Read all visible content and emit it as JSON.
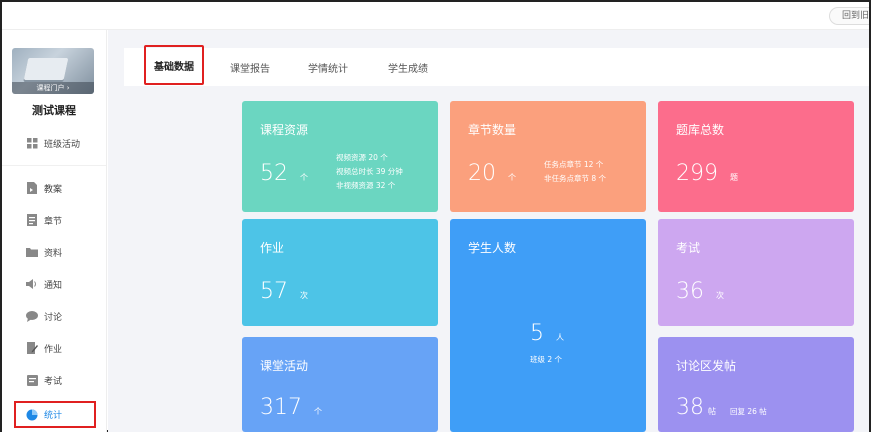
{
  "topbar": {
    "back_label": "回到旧"
  },
  "sidebar": {
    "portal_label": "课程门户 ›",
    "course_name": "测试课程",
    "items": [
      {
        "label": "班级活动",
        "icon": "grid-icon"
      },
      {
        "label": "教案",
        "icon": "doc-icon"
      },
      {
        "label": "章节",
        "icon": "list-icon"
      },
      {
        "label": "资料",
        "icon": "folder-icon"
      },
      {
        "label": "通知",
        "icon": "speaker-icon"
      },
      {
        "label": "讨论",
        "icon": "chat-icon"
      },
      {
        "label": "作业",
        "icon": "edit-icon"
      },
      {
        "label": "考试",
        "icon": "exam-icon"
      },
      {
        "label": "统计",
        "icon": "pie-icon"
      }
    ],
    "active_color": "#1e88e5"
  },
  "tabs": [
    "基础数据",
    "课堂报告",
    "学情统计",
    "学生成绩"
  ],
  "cards": {
    "resources": {
      "title": "课程资源",
      "value": "52",
      "unit": "个",
      "details": [
        "视频资源 20 个",
        "视频总时长 39 分钟",
        "非视频资源 32 个"
      ],
      "color": "#6bd6c1"
    },
    "chapters": {
      "title": "章节数量",
      "value": "20",
      "unit": "个",
      "details": [
        "任务点章节 12 个",
        "非任务点章节 8 个"
      ],
      "color": "#fba07d"
    },
    "questions": {
      "title": "题库总数",
      "value": "299",
      "unit": "题",
      "color": "#fc6d8c"
    },
    "homework": {
      "title": "作业",
      "value": "57",
      "unit": "次",
      "color": "#4dc4e7"
    },
    "students": {
      "title": "学生人数",
      "value": "5",
      "unit": "人",
      "detail": "班级 2 个",
      "color": "#3f9ef7"
    },
    "exams": {
      "title": "考试",
      "value": "36",
      "unit": "次",
      "color": "#cda7f0"
    },
    "activities": {
      "title": "课堂活动",
      "value": "317",
      "unit": "个",
      "color": "#67a3f6"
    },
    "posts": {
      "title": "讨论区发帖",
      "value": "38",
      "unit": "帖",
      "detail": "回复 26 帖",
      "color": "#9c91f0"
    }
  }
}
